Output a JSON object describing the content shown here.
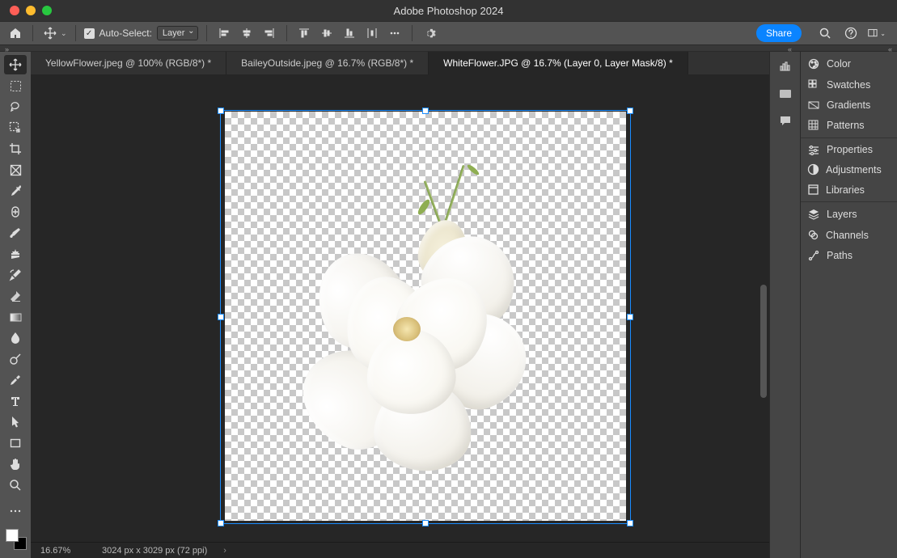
{
  "app": {
    "title": "Adobe Photoshop 2024"
  },
  "options": {
    "auto_select_label": "Auto-Select:",
    "auto_select_target": "Layer",
    "share_label": "Share"
  },
  "tabs": [
    {
      "label": "YellowFlower.jpeg @ 100% (RGB/8*) *",
      "active": false
    },
    {
      "label": "BaileyOutside.jpeg @ 16.7% (RGB/8*) *",
      "active": false
    },
    {
      "label": "WhiteFlower.JPG @ 16.7% (Layer 0, Layer Mask/8) *",
      "active": true
    }
  ],
  "status": {
    "zoom": "16.67%",
    "doc_info": "3024 px x 3029 px (72 ppi)"
  },
  "tools": [
    "move-tool",
    "marquee-tool",
    "lasso-tool",
    "object-select-tool",
    "crop-tool",
    "frame-tool",
    "eyedropper-tool",
    "healing-brush-tool",
    "brush-tool",
    "clone-stamp-tool",
    "history-brush-tool",
    "eraser-tool",
    "gradient-tool",
    "blur-tool",
    "dodge-tool",
    "pen-tool",
    "type-tool",
    "path-select-tool",
    "rectangle-tool",
    "hand-tool",
    "zoom-tool"
  ],
  "panel_groups": [
    {
      "items": [
        {
          "icon": "color",
          "label": "Color"
        },
        {
          "icon": "swatches",
          "label": "Swatches"
        },
        {
          "icon": "gradients",
          "label": "Gradients"
        },
        {
          "icon": "patterns",
          "label": "Patterns"
        }
      ]
    },
    {
      "items": [
        {
          "icon": "properties",
          "label": "Properties"
        },
        {
          "icon": "adjustments",
          "label": "Adjustments"
        },
        {
          "icon": "libraries",
          "label": "Libraries"
        }
      ]
    },
    {
      "items": [
        {
          "icon": "layers",
          "label": "Layers"
        },
        {
          "icon": "channels",
          "label": "Channels"
        },
        {
          "icon": "paths",
          "label": "Paths"
        }
      ]
    }
  ],
  "rail_icons": [
    "histogram-icon",
    "history-icon",
    "comments-icon"
  ],
  "colors": {
    "accent": "#0a84ff",
    "panel": "#535353",
    "canvas": "#262626"
  }
}
